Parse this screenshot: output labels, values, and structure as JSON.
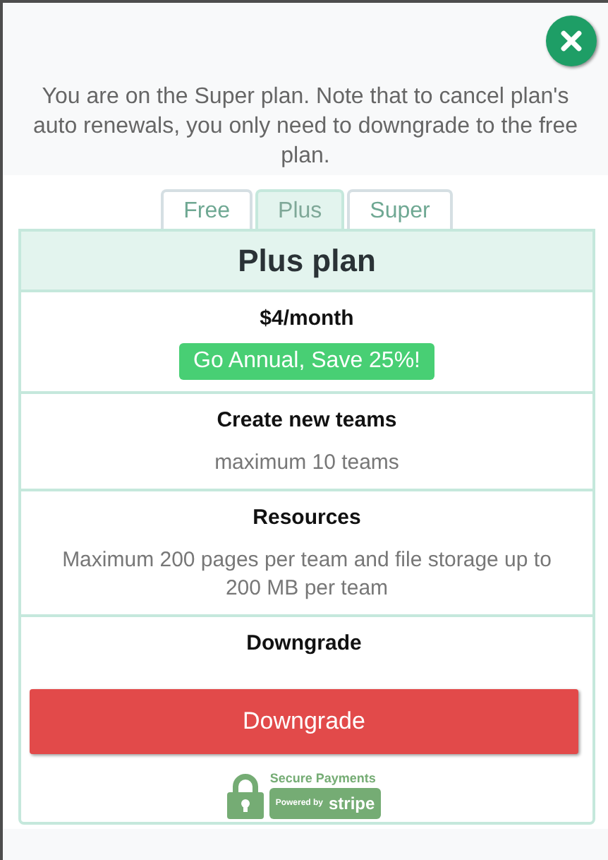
{
  "notice": "You are on the Super plan. Note that to cancel plan's auto renewals, you only need to downgrade to the free plan.",
  "tabs": [
    {
      "label": "Free",
      "selected": false
    },
    {
      "label": "Plus",
      "selected": true
    },
    {
      "label": "Super",
      "selected": false
    }
  ],
  "plan": {
    "title": "Plus plan",
    "sections": [
      {
        "kind": "price",
        "heading": "$4/month",
        "badge": "Go Annual, Save 25%!"
      },
      {
        "kind": "text",
        "heading": "Create new teams",
        "text": "maximum 10 teams"
      },
      {
        "kind": "text",
        "heading": "Resources",
        "text": "Maximum 200 pages per team and file storage up to 200 MB per team"
      },
      {
        "kind": "action",
        "heading": "Downgrade",
        "button": "Downgrade"
      }
    ],
    "secure": {
      "caption": "Secure Payments",
      "powered": "Powered by",
      "brand": "stripe"
    }
  }
}
